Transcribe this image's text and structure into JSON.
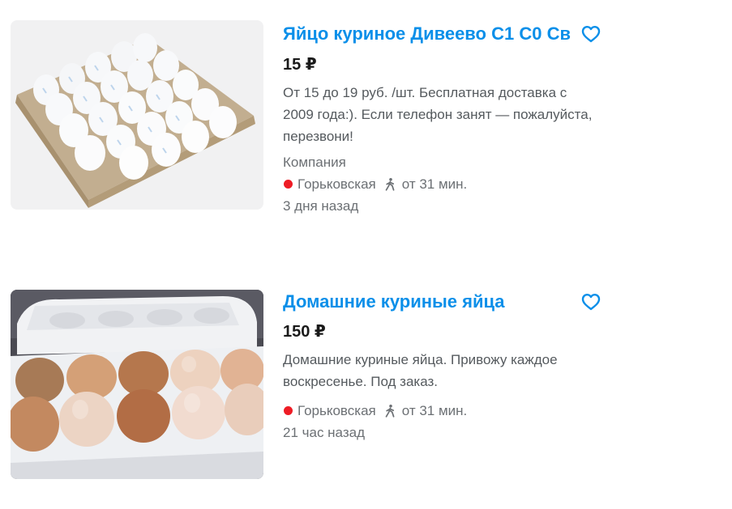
{
  "colors": {
    "accent": "#0a8fe9",
    "metro": "#ee1c25",
    "text": "#1a1a1a",
    "muted": "#6c7074"
  },
  "icons": {
    "favorite": "heart-outline-icon",
    "walk": "walking-person-icon",
    "metro": "metro-line-dot-icon"
  },
  "listings": [
    {
      "title": "Яйцо куриное Дивеево С1 С0 Св",
      "price": "15 ₽",
      "description": "От 15 до 19 руб. /шт. Бесплатная доставка с 2009 года:). Если телефон занят — пожалуйста, перезвони!",
      "seller": "Компания",
      "metro": "Горьковская",
      "walk_time": "от 31 мин.",
      "date": "3 дня назад"
    },
    {
      "title": "Домашние куриные яйца",
      "price": "150 ₽",
      "description": "Домашние куриные яйца. Привожу каждое воскресенье. Под заказ.",
      "metro": "Горьковская",
      "walk_time": "от 31 мин.",
      "date": "21 час назад"
    }
  ]
}
